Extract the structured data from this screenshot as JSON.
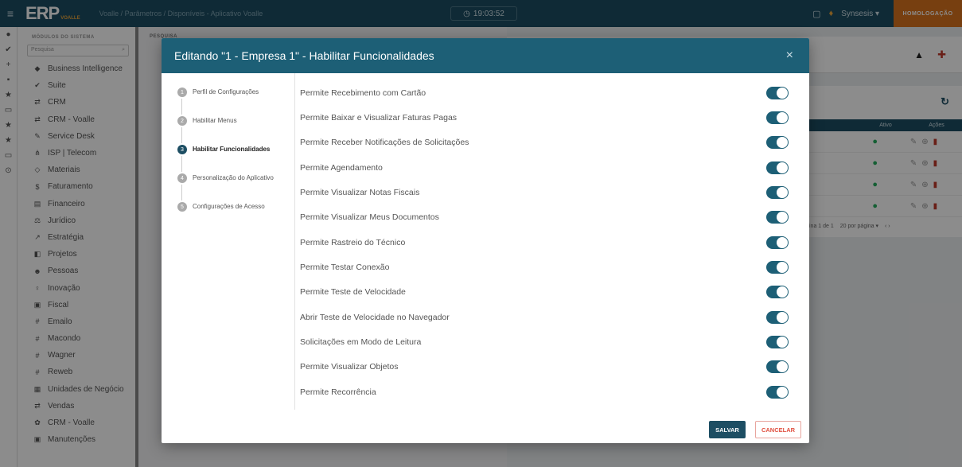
{
  "topbar": {
    "logo": "ERP",
    "logo_sub": "VOALLE",
    "breadcrumb": "Voalle  /  Parâmetros  /  Disponíveis - Aplicativo Voalle",
    "clock": "19:03:52",
    "clock_icon": "clock-icon",
    "company": "Synsesis ▾",
    "homolog": "HOMOLOGAÇÃO"
  },
  "sidebar": {
    "title": "MÓDULOS DO SISTEMA",
    "search_placeholder": "Pesquisa",
    "items": [
      {
        "icon": "chart-icon",
        "glyph": "◆",
        "label": "Business Intelligence"
      },
      {
        "icon": "suite-icon",
        "glyph": "✔",
        "label": "Suite"
      },
      {
        "icon": "handshake-icon",
        "glyph": "⇄",
        "label": "CRM"
      },
      {
        "icon": "handshake-icon",
        "glyph": "⇄",
        "label": "CRM - Voalle"
      },
      {
        "icon": "wrench-icon",
        "glyph": "✎",
        "label": "Service Desk"
      },
      {
        "icon": "network-icon",
        "glyph": "⋔",
        "label": "ISP | Telecom"
      },
      {
        "icon": "tag-icon",
        "glyph": "◇",
        "label": "Materiais"
      },
      {
        "icon": "dollar-icon",
        "glyph": "$",
        "label": "Faturamento"
      },
      {
        "icon": "ledger-icon",
        "glyph": "▤",
        "label": "Financeiro"
      },
      {
        "icon": "gavel-icon",
        "glyph": "⚖",
        "label": "Jurídico"
      },
      {
        "icon": "trend-icon",
        "glyph": "↗",
        "label": "Estratégia"
      },
      {
        "icon": "projects-icon",
        "glyph": "◧",
        "label": "Projetos"
      },
      {
        "icon": "people-icon",
        "glyph": "☻",
        "label": "Pessoas"
      },
      {
        "icon": "bulb-icon",
        "glyph": "♀",
        "label": "Inovação"
      },
      {
        "icon": "fiscal-icon",
        "glyph": "▣",
        "label": "Fiscal"
      },
      {
        "icon": "hash-icon",
        "glyph": "#",
        "label": "Emailo"
      },
      {
        "icon": "hash-icon",
        "glyph": "#",
        "label": "Macondo"
      },
      {
        "icon": "hash-icon",
        "glyph": "#",
        "label": "Wagner"
      },
      {
        "icon": "hash-icon",
        "glyph": "#",
        "label": "Reweb"
      },
      {
        "icon": "building-icon",
        "glyph": "▦",
        "label": "Unidades de Negócio"
      },
      {
        "icon": "handshake-icon",
        "glyph": "⇄",
        "label": "Vendas"
      },
      {
        "icon": "gear-icon",
        "glyph": "✿",
        "label": "CRM - Voalle"
      },
      {
        "icon": "toolbox-icon",
        "glyph": "▣",
        "label": "Manutenções"
      }
    ]
  },
  "background": {
    "label": "PESQUISA",
    "table_headers": [
      "Ativo",
      "Ações"
    ],
    "rows": 4,
    "pager": {
      "text": "ina  1  de 1",
      "per_page": "20 por página   ▾",
      "nav": "‹   ›"
    }
  },
  "modal": {
    "title": "Editando \"1 - Empresa 1\" - Habilitar Funcionalidades",
    "close": "×",
    "steps": [
      {
        "num": "1",
        "label": "Perfil de Configurações",
        "active": false
      },
      {
        "num": "2",
        "label": "Habilitar Menus",
        "active": false
      },
      {
        "num": "3",
        "label": "Habilitar Funcionalidades",
        "active": true
      },
      {
        "num": "4",
        "label": "Personalização do Aplicativo",
        "active": false
      },
      {
        "num": "5",
        "label": "Configurações de Acesso",
        "active": false
      }
    ],
    "toggles": [
      {
        "label": "Permite Recebimento com Cartão",
        "on": true
      },
      {
        "label": "Permite Baixar e Visualizar Faturas Pagas",
        "on": true
      },
      {
        "label": "Permite Receber Notificações de Solicitações",
        "on": true
      },
      {
        "label": "Permite Agendamento",
        "on": true
      },
      {
        "label": "Permite Visualizar Notas Fiscais",
        "on": true
      },
      {
        "label": "Permite Visualizar Meus Documentos",
        "on": true
      },
      {
        "label": "Permite Rastreio do Técnico",
        "on": true
      },
      {
        "label": "Permite Testar Conexão",
        "on": true
      },
      {
        "label": "Permite Teste de Velocidade",
        "on": true
      },
      {
        "label": "Abrir Teste de Velocidade no Navegador",
        "on": true
      },
      {
        "label": "Solicitações em Modo de Leitura",
        "on": true
      },
      {
        "label": "Permite Visualizar Objetos",
        "on": true
      },
      {
        "label": "Permite Recorrência",
        "on": true
      }
    ],
    "save_label": "SALVAR",
    "cancel_label": "CANCELAR"
  },
  "colors": {
    "primary": "#1d5f76",
    "accent": "#d9741e",
    "danger": "#e05040",
    "success": "#27ae60"
  }
}
